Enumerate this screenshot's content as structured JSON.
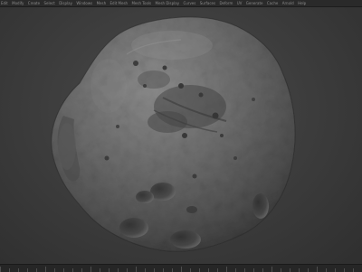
{
  "menu": {
    "items": [
      "Edit",
      "Modify",
      "Create",
      "Select",
      "Display",
      "Windows",
      "Mesh",
      "Edit Mesh",
      "Mesh Tools",
      "Mesh Display",
      "Curves",
      "Surfaces",
      "Deform",
      "UV",
      "Generate",
      "Cache",
      "Arnold",
      "Help"
    ]
  },
  "viewport": {
    "model": "asteroid"
  },
  "timeline": {
    "ticks": 40
  }
}
